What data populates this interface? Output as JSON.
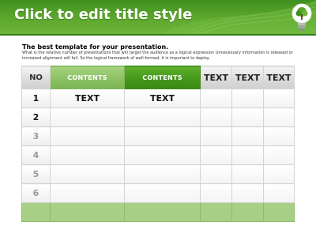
{
  "header": {
    "title": "Click to edit title style",
    "icon": "lightbulb-tree-icon"
  },
  "intro": {
    "subtitle": "The best template for your presentation.",
    "body": "What is the relative number of presentations that will target the audience as a logical expression Unnecessary information is released or increased alignment will fail. So the logical framework of well-formed, it is important to deploy."
  },
  "table": {
    "headers": [
      "NO",
      "CONTENTS",
      "CONTENTS",
      "TEXT",
      "TEXT",
      "TEXT"
    ],
    "rows": [
      {
        "no": "1",
        "cells": [
          "TEXT",
          "TEXT",
          "",
          "",
          ""
        ],
        "no_color": "#111111"
      },
      {
        "no": "2",
        "cells": [
          "",
          "",
          "",
          "",
          ""
        ],
        "no_color": "#111111"
      },
      {
        "no": "3",
        "cells": [
          "",
          "",
          "",
          "",
          ""
        ],
        "no_color": "#9a9a9a"
      },
      {
        "no": "4",
        "cells": [
          "",
          "",
          "",
          "",
          ""
        ],
        "no_color": "#9a9a9a"
      },
      {
        "no": "5",
        "cells": [
          "",
          "",
          "",
          "",
          ""
        ],
        "no_color": "#9a9a9a"
      },
      {
        "no": "6",
        "cells": [
          "",
          "",
          "",
          "",
          ""
        ],
        "no_color": "#9a9a9a"
      }
    ]
  },
  "colors": {
    "banner_green": "#5aa52b",
    "header_contents_light": "#8bc162",
    "header_contents_dark": "#45981a",
    "footer_row": "#a7cf86"
  }
}
